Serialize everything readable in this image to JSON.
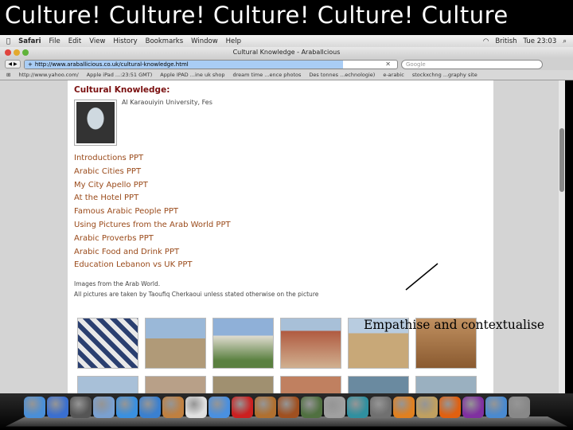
{
  "slide_title": "Culture! Culture! Culture! Culture! Culture",
  "menubar": {
    "items": [
      "Safari",
      "File",
      "Edit",
      "View",
      "History",
      "Bookmarks",
      "Window",
      "Help"
    ],
    "status": [
      "British",
      "Tue 23:03"
    ]
  },
  "window": {
    "title": "Cultural Knowledge - Araballcious"
  },
  "toolbar": {
    "url": "http://www.araballicious.co.uk/cultural-knowledge.html",
    "search_placeholder": "Google"
  },
  "bookmarks": [
    "http://www.yahoo.com/",
    "Apple iPad ...:23:51 GMT)",
    "Apple IPAD ...ine uk shop",
    "dream time ...ence photos",
    "Des tonnes ...echnologie)",
    "e-arabic",
    "stockxchng ...graphy site"
  ],
  "page": {
    "heading": "Cultural Knowledge:",
    "photo_caption": "Al Karaouiyin University, Fes",
    "links": [
      "Introductions PPT",
      "Arabic Cities PPT",
      "My City Apello PPT",
      "At the Hotel PPT",
      "Famous Arabic People PPT",
      "Using Pictures from the Arab World PPT",
      "Arabic Proverbs PPT",
      "Arabic Food and Drink PPT",
      "Education Lebanon vs UK PPT"
    ],
    "note_1": "Images from the Arab World.",
    "note_2": "All pictures are taken by Taoufiq Cherkaoui unless stated otherwise on the picture"
  },
  "annotation": "Empathise and contextualise",
  "dock_colors": [
    "#4a8fd8",
    "#3a6fd0",
    "#555",
    "#7aa0d0",
    "#3a90e0",
    "#3a80d0",
    "#c08040",
    "#e0e0e0",
    "#4a90e0",
    "#cc2020",
    "#b07030",
    "#a05020",
    "#507040",
    "#a0a0a0",
    "#3090a0",
    "#707070",
    "#e08020",
    "#c0a060",
    "#e06010",
    "#8030a0",
    "#4a8ad0",
    "#888"
  ]
}
